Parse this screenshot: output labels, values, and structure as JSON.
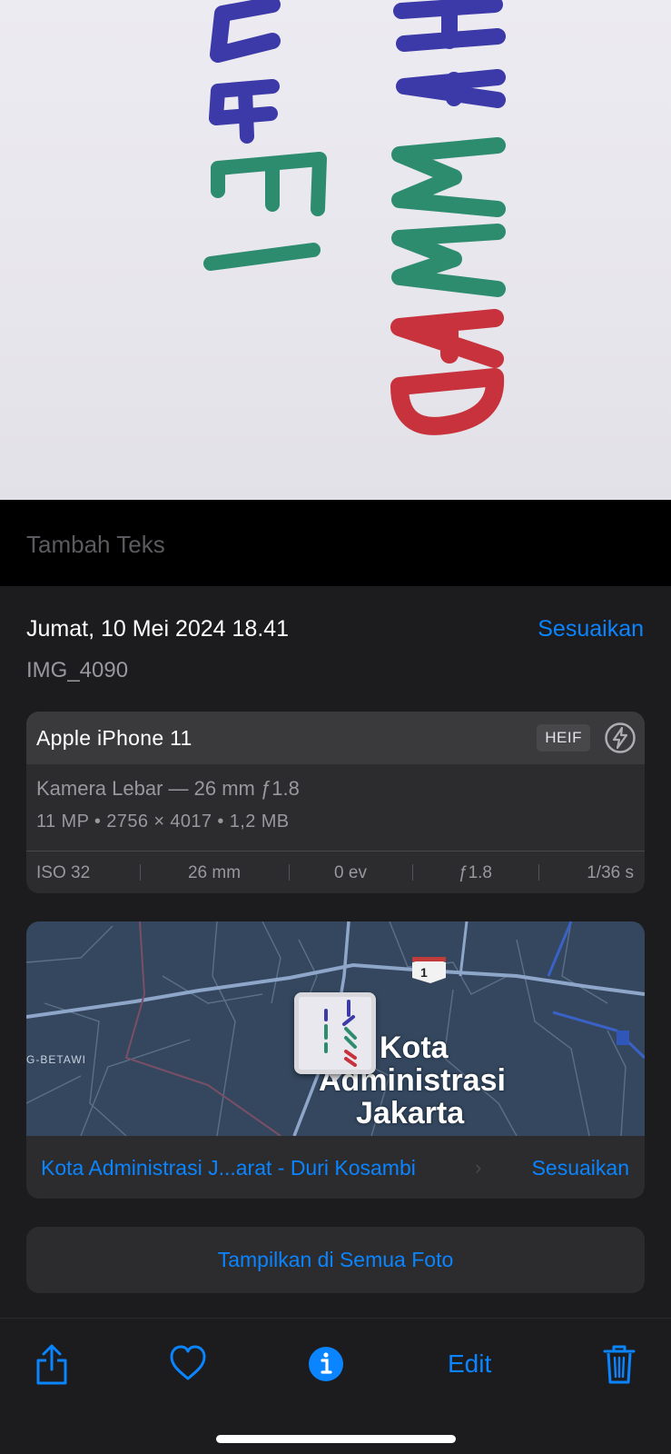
{
  "caption": {
    "placeholder": "Tambah Teks"
  },
  "info": {
    "date": "Jumat, 10 Mei 2024 18.41",
    "adjust_label": "Sesuaikan",
    "filename": "IMG_4090"
  },
  "camera": {
    "device": "Apple iPhone 11",
    "format": "HEIF",
    "lens": "Kamera Lebar — 26 mm ƒ1.8",
    "specs": "11 MP  •  2756 × 4017  •  1,2 MB",
    "exif": [
      {
        "label": "ISO 32"
      },
      {
        "label": "26 mm"
      },
      {
        "label": "0 ev"
      },
      {
        "label": "ƒ1.8"
      },
      {
        "label": "1/36 s"
      }
    ]
  },
  "map": {
    "place_line1": "Kota",
    "place_line2": "Administrasi",
    "place_line3": "Jakarta",
    "street_label": "G-BETAWI",
    "road_shield": "1",
    "location_text": "Kota Administrasi J...arat - Duri Kosambi",
    "location_adjust": "Sesuaikan"
  },
  "show_all_label": "Tampilkan di Semua Foto",
  "toolbar": {
    "share_icon": "share-icon",
    "favorite_icon": "heart-icon",
    "info_icon": "info-icon",
    "edit_label": "Edit",
    "delete_icon": "trash-icon"
  },
  "photo_content": {
    "line1": "MUHAMMAD",
    "line2": "RAFI"
  },
  "colors": {
    "accent": "#0a84ff",
    "panel": "#1c1c1e",
    "card": "#2c2c2e",
    "ink_blue": "#3b3aa8",
    "ink_green": "#2e8c6e",
    "ink_red": "#c8323c"
  }
}
